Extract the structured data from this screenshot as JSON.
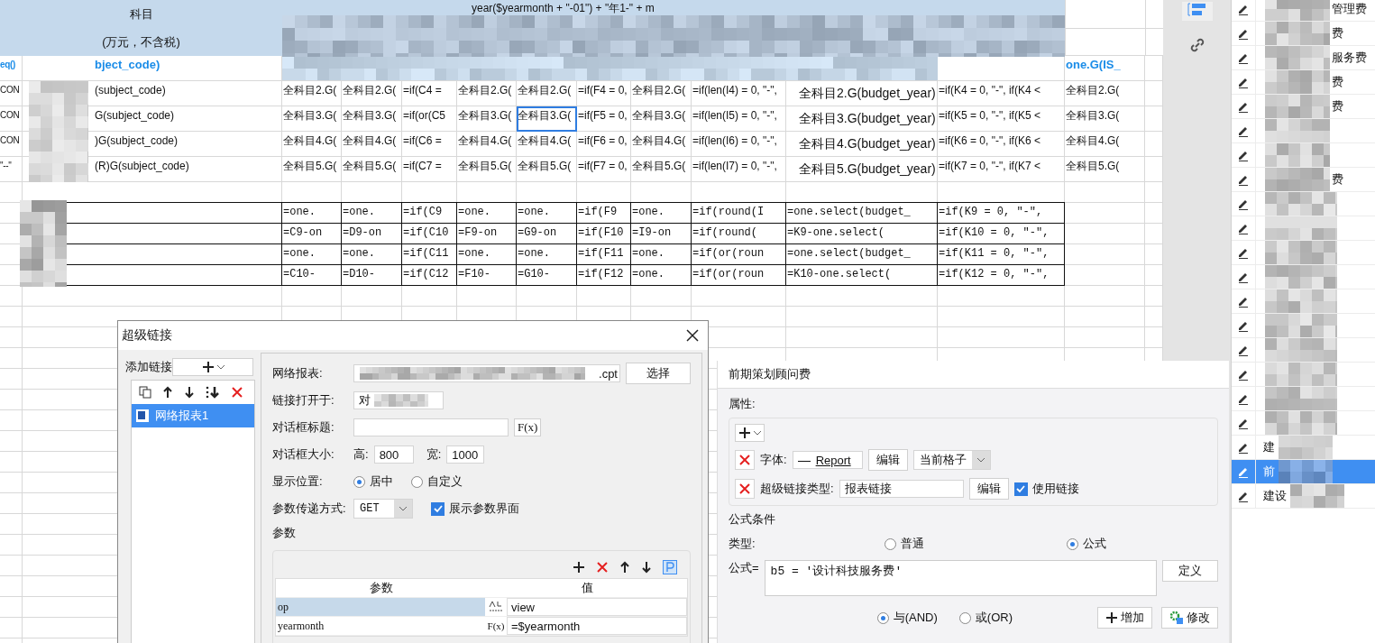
{
  "sheet": {
    "header": {
      "title": "科目",
      "unit": "(万元，不含税)",
      "formula": "year($yearmonth + \"-01\") + \"年1-\" + m"
    },
    "rows": [
      {
        "kind": "field",
        "cells": [
          {
            "text": "eq()",
            "selected": false
          },
          {
            "text": "bject_code)",
            "selected": false
          },
          null,
          null,
          null,
          null,
          null,
          null,
          null,
          null,
          null,
          null,
          {
            "text": "one.G(IS_",
            "selected": false
          }
        ]
      },
      {
        "kind": "formula",
        "cells": [
          {
            "text": "CON",
            "selected": false
          },
          {
            "text": "(subject_code)",
            "selected": false
          },
          {
            "text": "全科目2.G(",
            "selected": false
          },
          {
            "text": "全科目2.G(",
            "selected": false
          },
          {
            "text": "=if(C4 =",
            "selected": false
          },
          {
            "text": "全科目2.G(",
            "selected": false
          },
          {
            "text": "全科目2.G(",
            "selected": false
          },
          {
            "text": "=if(F4 = 0,",
            "selected": false
          },
          {
            "text": "全科目2.G(",
            "selected": false
          },
          {
            "text": "=if(len(I4) = 0, \"-\",",
            "selected": false
          },
          {
            "text": "全科目2.G(budget_year)",
            "selected": false
          },
          {
            "text": "=if(K4 = 0, \"-\", if(K4 <",
            "selected": false
          },
          {
            "text": "全科目2.G(",
            "selected": false
          }
        ]
      },
      {
        "kind": "formula",
        "cells": [
          {
            "text": "CON",
            "selected": false
          },
          {
            "text": "G(subject_code)",
            "selected": false
          },
          {
            "text": "全科目3.G(",
            "selected": false
          },
          {
            "text": "全科目3.G(",
            "selected": false
          },
          {
            "text": "=if(or(C5",
            "selected": false
          },
          {
            "text": "全科目3.G(",
            "selected": false
          },
          {
            "text": "全科目3.G(",
            "selected": true
          },
          {
            "text": "=if(F5 = 0,",
            "selected": false
          },
          {
            "text": "全科目3.G(",
            "selected": false
          },
          {
            "text": "=if(len(I5) = 0, \"-\",",
            "selected": false
          },
          {
            "text": "全科目3.G(budget_year)",
            "selected": false
          },
          {
            "text": "=if(K5 = 0, \"-\", if(K5 <",
            "selected": false
          },
          {
            "text": "全科目3.G(",
            "selected": false
          }
        ]
      },
      {
        "kind": "formula",
        "cells": [
          {
            "text": "CON",
            "selected": false
          },
          {
            "text": ")G(subject_code)",
            "selected": false
          },
          {
            "text": "全科目4.G(",
            "selected": false
          },
          {
            "text": "全科目4.G(",
            "selected": false
          },
          {
            "text": "=if(C6 =",
            "selected": false
          },
          {
            "text": "全科目4.G(",
            "selected": false
          },
          {
            "text": "全科目4.G(",
            "selected": false
          },
          {
            "text": "=if(F6 = 0,",
            "selected": false
          },
          {
            "text": "全科目4.G(",
            "selected": false
          },
          {
            "text": "=if(len(I6) = 0, \"-\",",
            "selected": false
          },
          {
            "text": "全科目4.G(budget_year)",
            "selected": false
          },
          {
            "text": "=if(K6 = 0, \"-\", if(K6 <",
            "selected": false
          },
          {
            "text": "全科目4.G(",
            "selected": false
          }
        ]
      },
      {
        "kind": "formula",
        "cells": [
          {
            "text": "\"--\"",
            "selected": false
          },
          {
            "text": "(R)G(subject_code)",
            "selected": false
          },
          {
            "text": "全科目5.G(",
            "selected": false
          },
          {
            "text": "全科目5.G(",
            "selected": false
          },
          {
            "text": "=if(C7 =",
            "selected": false
          },
          {
            "text": "全科目5.G(",
            "selected": false
          },
          {
            "text": "全科目5.G(",
            "selected": false
          },
          {
            "text": "=if(F7 = 0,",
            "selected": false
          },
          {
            "text": "全科目5.G(",
            "selected": false
          },
          {
            "text": "=if(len(I7) = 0, \"-\",",
            "selected": false
          },
          {
            "text": "全科目5.G(budget_year)",
            "selected": false
          },
          {
            "text": "=if(K7 = 0, \"-\", if(K7 <",
            "selected": false
          },
          {
            "text": "全科目5.G(",
            "selected": false
          }
        ]
      },
      {
        "kind": "blank",
        "cells": []
      },
      {
        "kind": "block",
        "cells": [
          null,
          null,
          {
            "text": "=one.",
            "selected": false
          },
          {
            "text": "=one.",
            "selected": false
          },
          {
            "text": "=if(C9",
            "selected": false
          },
          {
            "text": "=one.",
            "selected": false
          },
          {
            "text": "=one.",
            "selected": false
          },
          {
            "text": "=if(F9",
            "selected": false
          },
          {
            "text": "=one.",
            "selected": false
          },
          {
            "text": "=if(round(I",
            "selected": false
          },
          {
            "text": "=one.select(budget_",
            "selected": false
          },
          {
            "text": "=if(K9 = 0,  \"-\",",
            "selected": false
          },
          null
        ]
      },
      {
        "kind": "block",
        "cells": [
          null,
          null,
          {
            "text": "=C9-on",
            "selected": false
          },
          {
            "text": "=D9-on",
            "selected": false
          },
          {
            "text": "=if(C10",
            "selected": false
          },
          {
            "text": "=F9-on",
            "selected": false
          },
          {
            "text": "=G9-on",
            "selected": false
          },
          {
            "text": "=if(F10",
            "selected": false
          },
          {
            "text": "=I9-on",
            "selected": false
          },
          {
            "text": "=if(round(",
            "selected": false
          },
          {
            "text": "=K9-one.select(",
            "selected": false
          },
          {
            "text": "=if(K10 = 0,  \"-\",",
            "selected": false
          },
          null
        ]
      },
      {
        "kind": "block",
        "cells": [
          null,
          null,
          {
            "text": "=one.",
            "selected": false
          },
          {
            "text": "=one.",
            "selected": false
          },
          {
            "text": "=if(C11",
            "selected": false
          },
          {
            "text": "=one.",
            "selected": false
          },
          {
            "text": "=one.",
            "selected": false
          },
          {
            "text": "=if(F11",
            "selected": false
          },
          {
            "text": "=one.",
            "selected": false
          },
          {
            "text": "=if(or(roun",
            "selected": false
          },
          {
            "text": "=one.select(budget_",
            "selected": false
          },
          {
            "text": "=if(K11 = 0,  \"-\",",
            "selected": false
          },
          null
        ]
      },
      {
        "kind": "block",
        "cells": [
          null,
          null,
          {
            "text": "=C10-",
            "selected": false
          },
          {
            "text": "=D10-",
            "selected": false
          },
          {
            "text": "=if(C12",
            "selected": false
          },
          {
            "text": "=F10-",
            "selected": false
          },
          {
            "text": "=G10-",
            "selected": false
          },
          {
            "text": "=if(F12",
            "selected": false
          },
          {
            "text": "=one.",
            "selected": false
          },
          {
            "text": "=if(or(roun",
            "selected": false
          },
          {
            "text": "=K10-one.select(",
            "selected": false
          },
          {
            "text": "=if(K12 = 0,  \"-\",",
            "selected": false
          },
          null
        ]
      }
    ]
  },
  "side_list": [
    {
      "kind": "tail",
      "text": "管理费",
      "selected": false
    },
    {
      "kind": "tail",
      "text": "费",
      "selected": false
    },
    {
      "kind": "tail",
      "text": "服务费",
      "selected": false
    },
    {
      "kind": "tail",
      "text": "费",
      "selected": false
    },
    {
      "kind": "tail",
      "text": "费",
      "selected": false
    },
    {
      "kind": "tail",
      "selected": false
    },
    {
      "kind": "tail",
      "selected": false
    },
    {
      "kind": "tail",
      "text": "费",
      "selected": false
    },
    {
      "kind": "head",
      "selected": false
    },
    {
      "kind": "head",
      "selected": false
    },
    {
      "kind": "head",
      "selected": false
    },
    {
      "kind": "head",
      "selected": false
    },
    {
      "kind": "head",
      "selected": false
    },
    {
      "kind": "head",
      "selected": false
    },
    {
      "kind": "head",
      "selected": false
    },
    {
      "kind": "head",
      "selected": false
    },
    {
      "kind": "head",
      "selected": false
    },
    {
      "kind": "head",
      "selected": false
    },
    {
      "kind": "head",
      "text": "建",
      "selected": false
    },
    {
      "kind": "head",
      "text": "前",
      "selected": true
    },
    {
      "kind": "head",
      "text": "建设",
      "selected": false
    }
  ],
  "link_dialog": {
    "title": "超级链接",
    "add_label": "添加链接",
    "links": [
      {
        "label": "网络报表1",
        "selected": true
      }
    ],
    "report_label": "网络报表:",
    "report_value": ".cpt",
    "choose_button": "选择",
    "open_in_label": "链接打开于:",
    "open_in_value": "对",
    "dialog_title_label": "对话框标题:",
    "formula_button": "F(x)",
    "size_label": "对话框大小:",
    "height_label": "高:",
    "height_value": "800",
    "width_label": "宽:",
    "width_value": "1000",
    "position_label": "显示位置:",
    "positions": [
      {
        "label": "居中",
        "selected": true
      },
      {
        "label": "自定义",
        "selected": false
      }
    ],
    "method_label": "参数传递方式:",
    "method_value": "GET",
    "show_params": {
      "label": "展示参数界面",
      "checked": true
    },
    "params_group": "参数",
    "params_columns": [
      "参数",
      "值"
    ],
    "params": [
      {
        "name": "op",
        "value": "view",
        "kind": "text",
        "selected": true
      },
      {
        "name": "yearmonth",
        "value": "=$yearmonth",
        "kind": "formula",
        "type_label": "F(x)",
        "selected": false
      }
    ]
  },
  "props_panel": {
    "title": "前期策划顾问费",
    "attributes_label": "属性:",
    "font_label": "字体:",
    "font_preview": "Report",
    "edit_button": "编辑",
    "scope_value": "当前格子",
    "link_type_label": "超级链接类型:",
    "link_type_value": "报表链接",
    "edit_button_2": "编辑",
    "use_link": {
      "label": "使用链接",
      "checked": true
    },
    "condition_group": "公式条件",
    "type_label": "类型:",
    "types": [
      {
        "label": "普通",
        "selected": false
      },
      {
        "label": "公式",
        "selected": true
      }
    ],
    "formula_label": "公式=",
    "formula_value": "b5 = '设计科技服务费'",
    "define_button": "定义",
    "logic": [
      {
        "label": "与(AND)",
        "selected": true
      },
      {
        "label": "或(OR)",
        "selected": false
      }
    ],
    "add_button": "增加",
    "modify_button": "修改"
  }
}
